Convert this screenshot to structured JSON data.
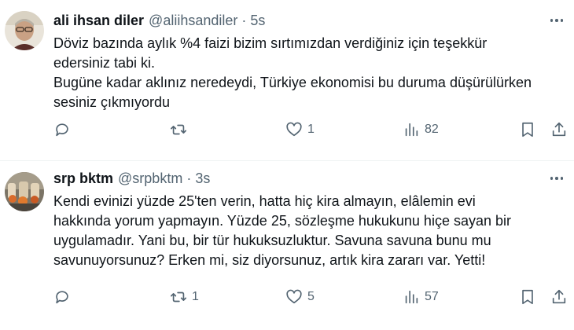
{
  "tweets": [
    {
      "author_name": "ali ihsan diler",
      "handle": "@aliihsandiler",
      "separator": "·",
      "time": "5s",
      "lines": [
        "Döviz bazında aylık %4 faizi bizim sırtımızdan verdiğiniz için teşekkür",
        "edersiniz tabi ki.",
        "Bugüne kadar aklınız neredeydi, Türkiye ekonomisi bu duruma düşürülürken",
        "sesiniz çıkmıyordu"
      ],
      "reply_count": "",
      "retweet_count": "",
      "like_count": "1",
      "view_count": "82",
      "icons": [
        "reply-icon",
        "retweet-icon",
        "like-icon",
        "views-icon",
        "bookmark-icon",
        "share-icon",
        "more-icon"
      ]
    },
    {
      "author_name": "srp bktm",
      "handle": "@srpbktm",
      "separator": "·",
      "time": "3s",
      "lines": [
        "Kendi evinizi yüzde 25'ten verin, hatta hiç kira almayın, elâlemin evi",
        "hakkında yorum yapmayın. Yüzde 25, sözleşme hukukunu hiçe sayan bir",
        "uygulamadır. Yani bu, bir tür hukuksuzluktur. Savuna savuna bunu mu",
        "savunuyorsunuz? Erken mi, siz diyorsunuz, artık kira zararı var. Yetti!"
      ],
      "reply_count": "",
      "retweet_count": "1",
      "like_count": "5",
      "view_count": "57",
      "icons": [
        "reply-icon",
        "retweet-icon",
        "like-icon",
        "views-icon",
        "bookmark-icon",
        "share-icon",
        "more-icon"
      ]
    }
  ],
  "colors": {
    "text": "#0f1419",
    "secondary": "#536471",
    "divider": "#eff3f4",
    "background": "#ffffff"
  }
}
